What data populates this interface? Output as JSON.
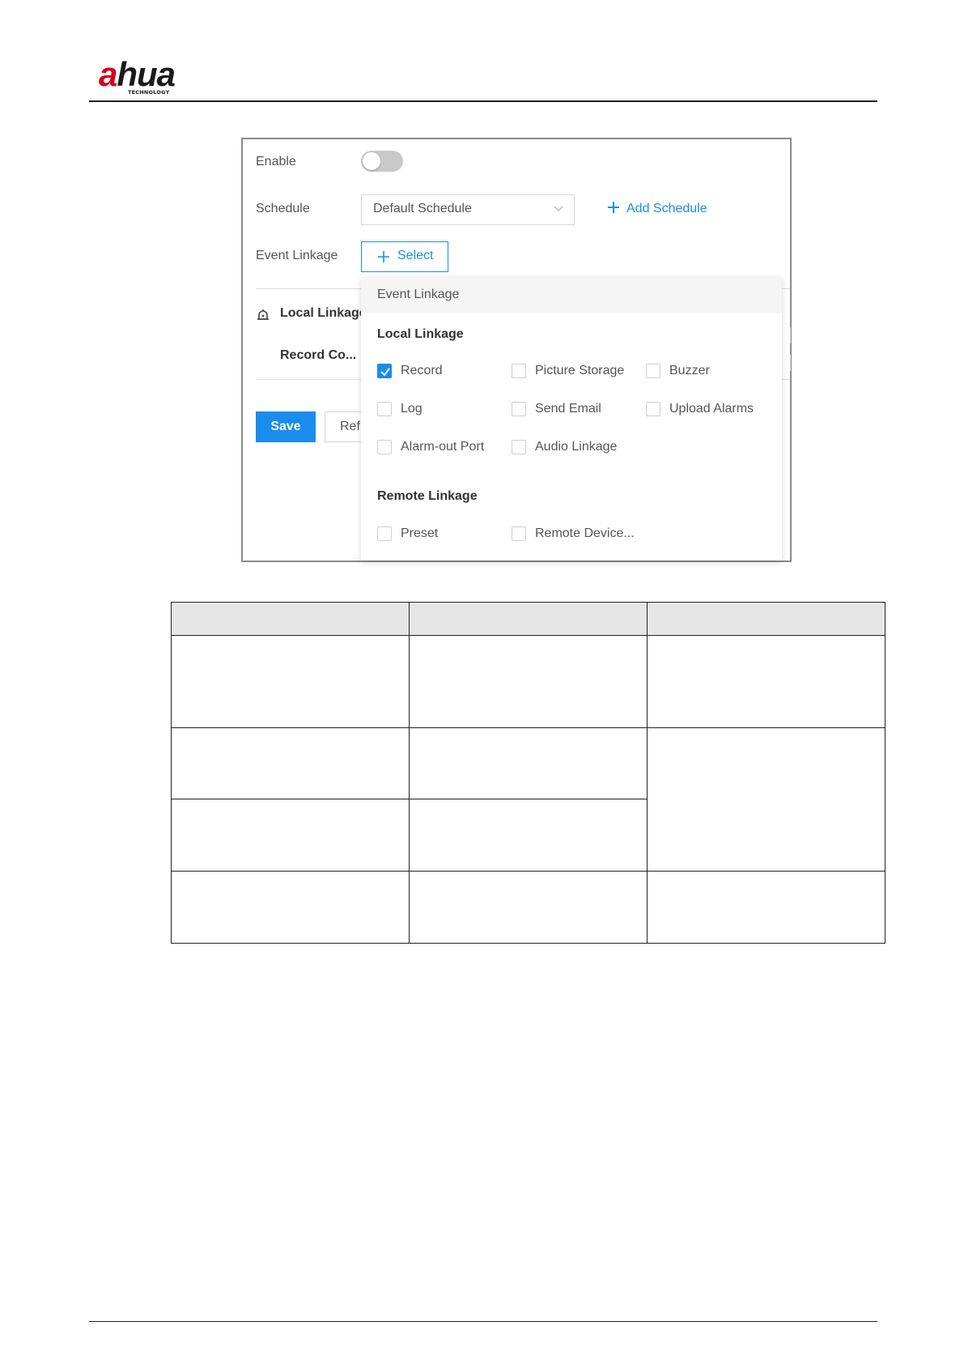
{
  "header": {
    "logo_text_a": "a",
    "logo_text_rest": "hua",
    "logo_sub": "TECHNOLOGY"
  },
  "form": {
    "enable_label": "Enable",
    "enable_on": false,
    "schedule_label": "Schedule",
    "schedule_value": "Default Schedule",
    "add_schedule": "Add Schedule",
    "event_linkage_label": "Event Linkage",
    "select_button": "Select",
    "local_linkage": "Local Linkage",
    "record_co": "Record Co...",
    "save": "Save",
    "refresh_partial": "Ref"
  },
  "dropdown": {
    "title": "Event Linkage",
    "local_title": "Local Linkage",
    "local_items": [
      {
        "label": "Record",
        "checked": true
      },
      {
        "label": "Picture Storage",
        "checked": false
      },
      {
        "label": "Buzzer",
        "checked": false
      },
      {
        "label": "Log",
        "checked": false
      },
      {
        "label": "Send Email",
        "checked": false
      },
      {
        "label": "Upload Alarms",
        "checked": false
      },
      {
        "label": "Alarm-out Port",
        "checked": false
      },
      {
        "label": "Audio Linkage",
        "checked": false
      }
    ],
    "remote_title": "Remote Linkage",
    "remote_items": [
      {
        "label": "Preset",
        "checked": false
      },
      {
        "label": "Remote Device...",
        "checked": false
      }
    ]
  },
  "colors": {
    "accent": "#1a8ced",
    "brand_red": "#d6001c",
    "header_fill": "#e6e6e6"
  }
}
